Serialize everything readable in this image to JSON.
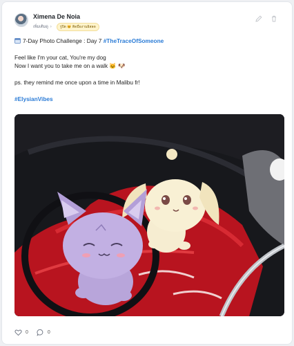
{
  "post": {
    "author": "Ximena De Noia",
    "meta_label": "เพิ่มเติมดู",
    "badge_label": "รูปิด 🐱 ติดมืองานอิสลด",
    "text": {
      "challenge_prefix": "7-Day Photo Challenge : Day 7 ",
      "challenge_tag": "#TheTraceOfSomeone",
      "line1": "Feel like I'm your cat, You're my dog",
      "line2": "Now I want you to take me on a walk 🐱 🐶",
      "line3": "ps. they remind me once upon a time in Malibu fr!",
      "hashtag": "#ElysianVibes"
    },
    "likes": "0",
    "comments": "0"
  },
  "colors": {
    "accent": "#2a7bd6",
    "card": "#ffffff",
    "page": "#eef0f3"
  },
  "icons": [
    "avatar",
    "chevron-right-icon",
    "crown-icon",
    "edit-icon",
    "trash-icon",
    "calendar-icon",
    "heart-icon",
    "comment-icon"
  ]
}
